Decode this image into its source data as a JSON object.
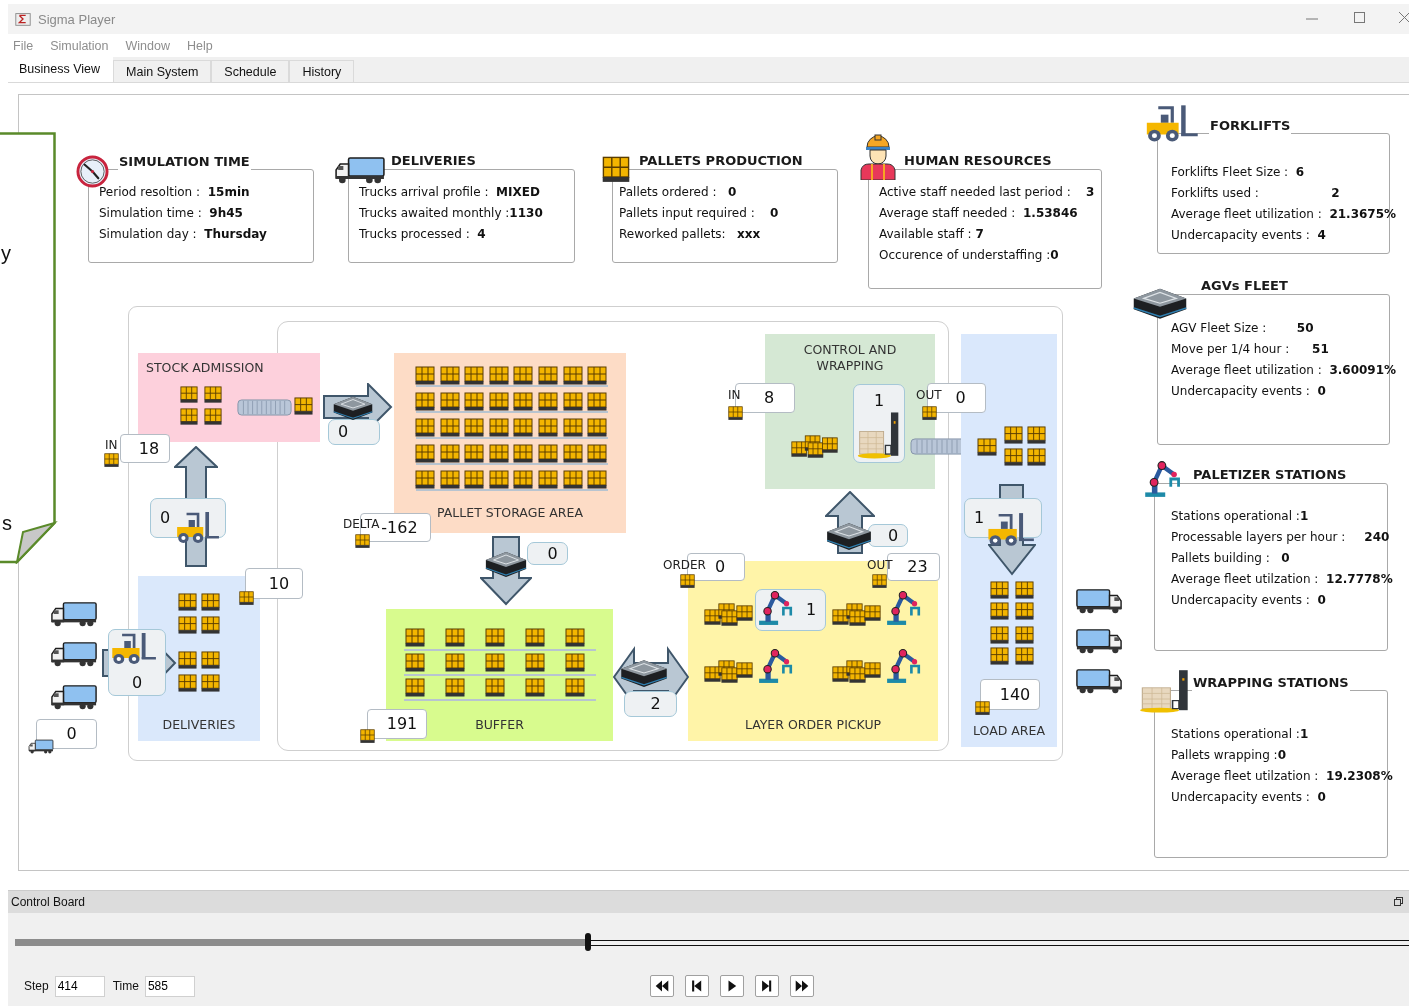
{
  "window": {
    "title": "Sigma Player"
  },
  "menu": [
    "File",
    "Simulation",
    "Window",
    "Help"
  ],
  "tabs": [
    {
      "label": "Business View",
      "selected": true
    },
    {
      "label": "Main System",
      "selected": false
    },
    {
      "label": "Schedule",
      "selected": false
    },
    {
      "label": "History",
      "selected": false
    }
  ],
  "callout": {
    "lines": [
      "y",
      "s"
    ]
  },
  "info_cards": [
    {
      "kind": "clock",
      "title": "SIMULATION TIME",
      "rows": [
        "Period resoltion :  **15min**",
        "Simulation time :  **9h45**",
        "Simulation day :  **Thursday**"
      ]
    },
    {
      "kind": "truck",
      "title": "DELIVERIES",
      "rows": [
        "Trucks arrival profile :  **MIXED**",
        "Trucks awaited monthly :**1130**",
        "Trucks processed :  **4**"
      ]
    },
    {
      "kind": "pallet",
      "title": "PALLETS PRODUCTION",
      "rows": [
        "Pallets ordered :   **0**",
        "Pallets input required :    **0**",
        "Reworked pallets:   **xxx**"
      ]
    },
    {
      "kind": "worker",
      "title": "HUMAN RESOURCES",
      "rows": [
        "Active staff needed last period :    **3**",
        "Average staff needed :  **1.53846**",
        "Available staff : **7**",
        "Occurence of understaffing :**0**"
      ]
    },
    {
      "kind": "forklift",
      "title": "FORKLIFTS",
      "rows": [
        "Forklifts Fleet Size :  **6**",
        "Forklifts used :                   **2**",
        "Average fleet utilization :  **21.3675%**",
        "Undercapacity events :  **4**"
      ]
    },
    {
      "kind": "agv",
      "title": "AGVs FLEET",
      "rows": [
        "AGV Fleet Size :        **50**",
        "Move per 1/4 hour :      **51**",
        "Average fleet utilization :  **3.60091%**",
        "Undercapacity events :  **0**"
      ]
    },
    {
      "kind": "robot",
      "title": "PALETIZER STATIONS",
      "rows": [
        "Stations operational :**1**",
        "Processable layers per hour :     **240**",
        "Pallets building :   **0**",
        "Average fleet utilzation :  **12.7778%**",
        "Undercapacity events :  **0**"
      ]
    },
    {
      "kind": "wrapper",
      "title": "WRAPPING STATIONS",
      "rows": [
        "Stations operational :**1**",
        "Pallets wrapping :**0**",
        "Average fleet utilzation :  **19.2308%**",
        "Undercapacity events :  **0**"
      ]
    }
  ],
  "diagram": {
    "zones": [
      {
        "kind": "stock_admission",
        "label": "STOCK ADMISSION",
        "color": "#fdd0dc"
      },
      {
        "kind": "pallet_storage",
        "label": "PALLET STORAGE AREA",
        "color": "#fddcc6"
      },
      {
        "kind": "control_wrapping",
        "label": "CONTROL AND WRAPPING",
        "color": "#d5e8d4"
      },
      {
        "kind": "load_area",
        "label": "LOAD AREA",
        "color": "#dae8fc"
      },
      {
        "kind": "deliveries",
        "label": "DELIVERIES",
        "color": "#dae8fb"
      },
      {
        "kind": "buffer",
        "label": "BUFFER",
        "color": "#d8fb8e"
      },
      {
        "kind": "layer_order_pickup",
        "label": "LAYER ORDER PICKUP",
        "color": "#fff4a8"
      }
    ],
    "counters": [
      {
        "label": "IN",
        "value": "18"
      },
      {
        "value": "0"
      },
      {
        "value": "0"
      },
      {
        "label": "DELTA",
        "value": "-162"
      },
      {
        "value": "0"
      },
      {
        "value": "10"
      },
      {
        "value": "0"
      },
      {
        "value": "0"
      },
      {
        "value": "191"
      },
      {
        "value": "2"
      },
      {
        "label": "ORDER",
        "value": "0"
      },
      {
        "value": "0"
      },
      {
        "label": "OUT",
        "value": "23"
      },
      {
        "label": "IN",
        "value": "8"
      },
      {
        "value": "1"
      },
      {
        "label": "OUT",
        "value": "0"
      },
      {
        "value": "1"
      },
      {
        "value": "1"
      },
      {
        "value": "140"
      }
    ]
  },
  "control_board": {
    "title": "Control Board",
    "slider": {
      "level": 0.411
    },
    "step": {
      "label": "Step",
      "value": "414"
    },
    "time": {
      "label": "Time",
      "value": "585"
    }
  }
}
